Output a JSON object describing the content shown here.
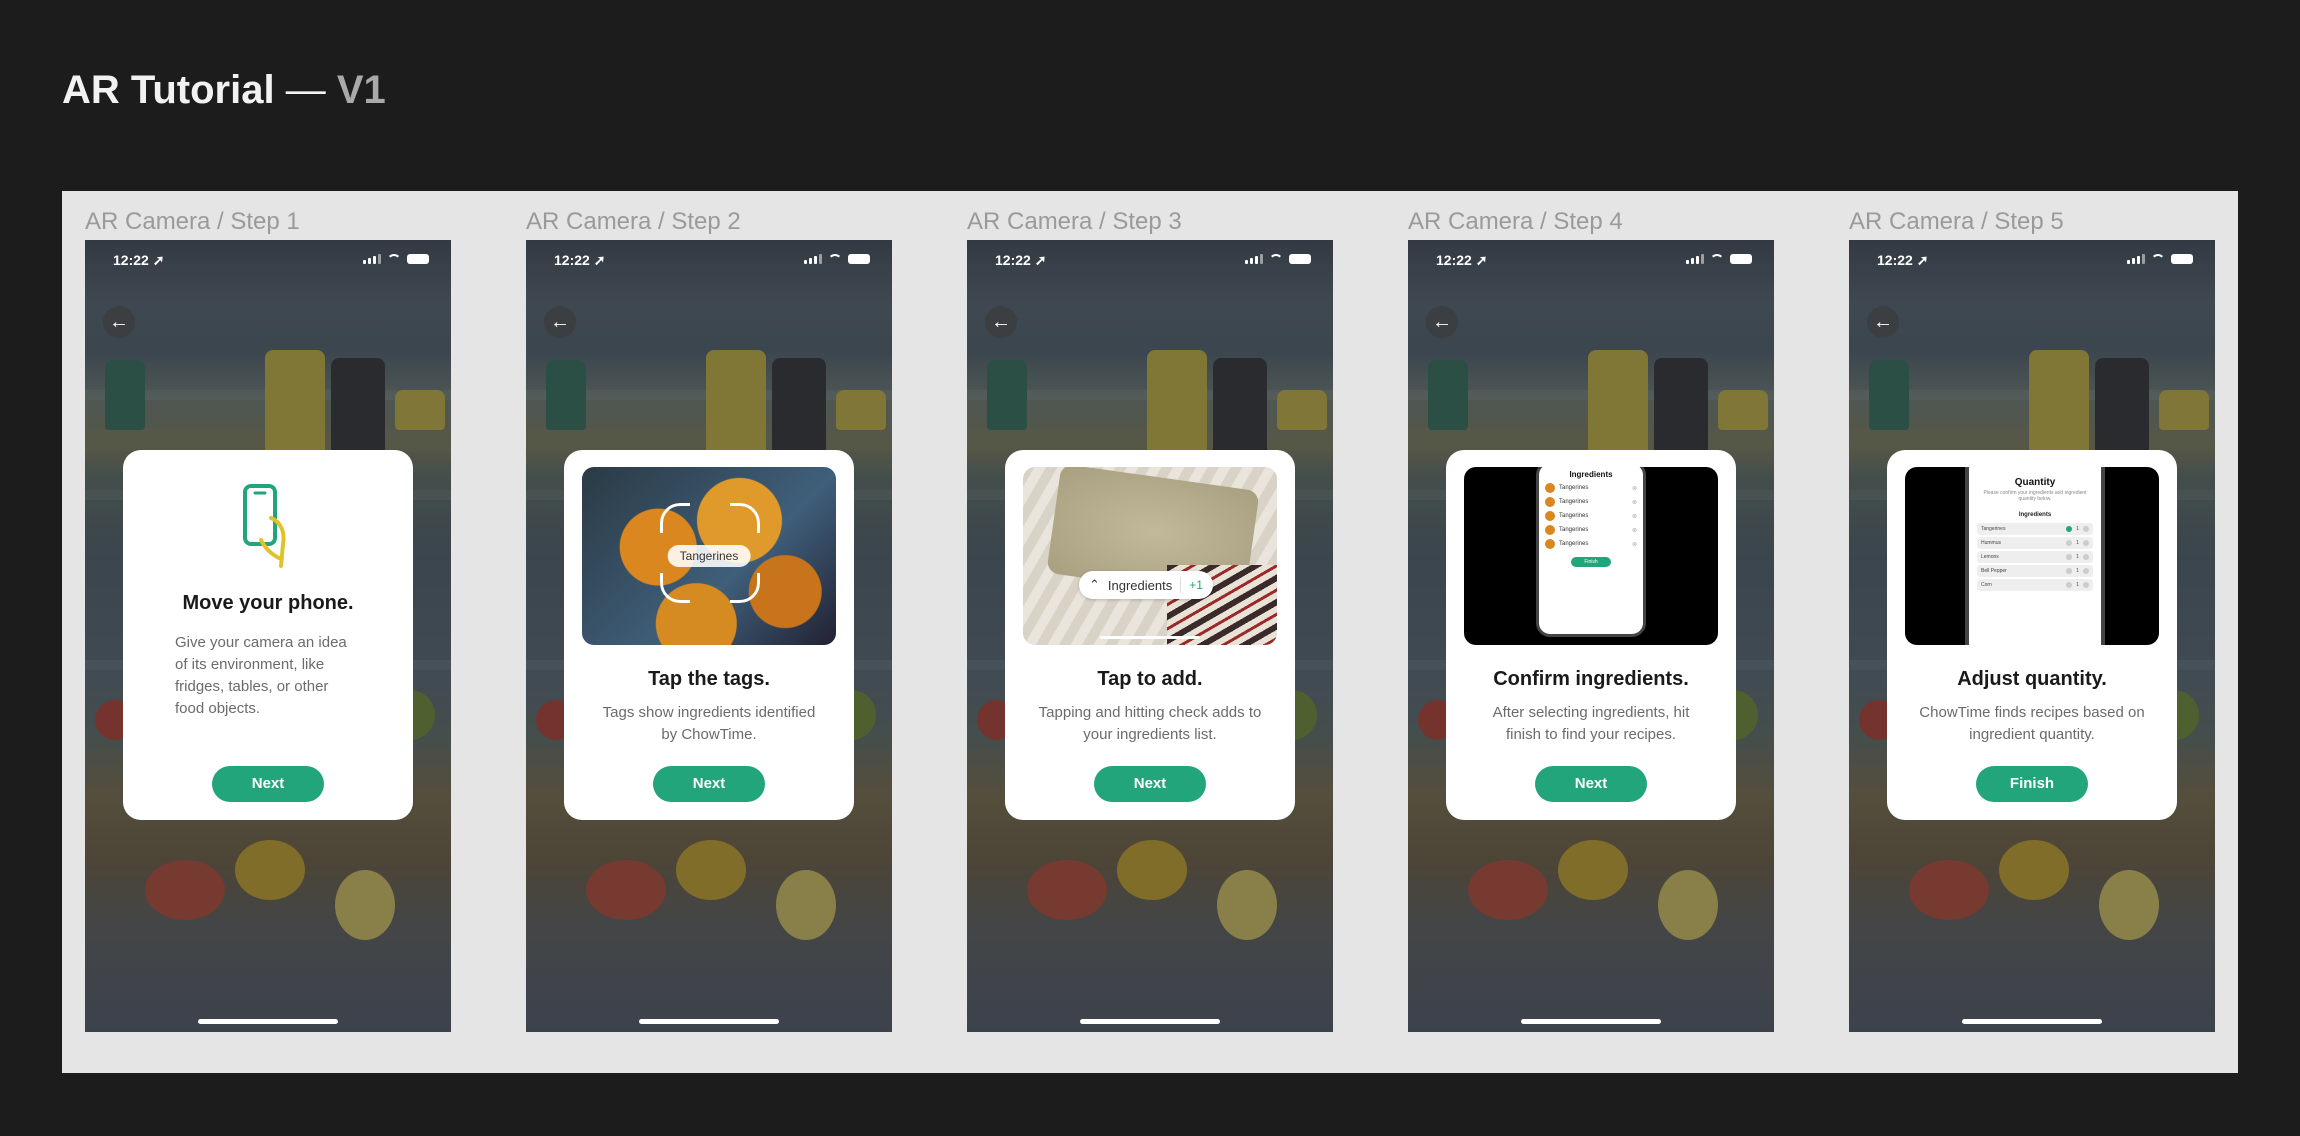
{
  "page": {
    "title": "AR Tutorial",
    "dash": "—",
    "version": "V1"
  },
  "status_time": "12:22 ➚",
  "frames": [
    {
      "label": "AR Camera / Step 1",
      "title": "Move your phone.",
      "body": "Give your camera an idea of its environment, like fridges, tables, or other food objects.",
      "button": "Next"
    },
    {
      "label": "AR Camera / Step 2",
      "title": "Tap the tags.",
      "body": "Tags show ingredients identified by ChowTime.",
      "button": "Next",
      "tag": "Tangerines"
    },
    {
      "label": "AR Camera / Step 3",
      "title": "Tap to add.",
      "body": "Tapping and hitting check adds to your ingredients list.",
      "button": "Next",
      "pill_label": "Ingredients",
      "pill_count": "+1"
    },
    {
      "label": "AR Camera / Step 4",
      "title": "Confirm ingredients.",
      "body": "After selecting ingredients, hit finish to find your recipes.",
      "button": "Next",
      "mini_title": "Ingredients",
      "mini_items": [
        "Tangerines",
        "Tangerines",
        "Tangerines",
        "Tangerines",
        "Tangerines"
      ],
      "mini_button": "Finish"
    },
    {
      "label": "AR Camera / Step 5",
      "title": "Adjust quantity.",
      "body": "ChowTime finds recipes based on ingredient quantity.",
      "button": "Finish",
      "mini_title": "Quantity",
      "mini_sub": "Please confirm your ingredients and ingredient quantity below.",
      "mini_section": "Ingredients",
      "mini_items": [
        "Tangerines",
        "Hummus",
        "Lemons",
        "Bell Pepper",
        "Corn"
      ]
    }
  ],
  "colors": {
    "background": "#1c1c1c",
    "board": "#e5e5e5",
    "accent": "#22a57a"
  },
  "icons": {
    "back": "arrow-left-icon",
    "phone": "hand-phone-icon",
    "signal": "signal-icon",
    "wifi": "wifi-icon",
    "battery": "battery-icon",
    "chevron": "chevron-up-icon"
  }
}
